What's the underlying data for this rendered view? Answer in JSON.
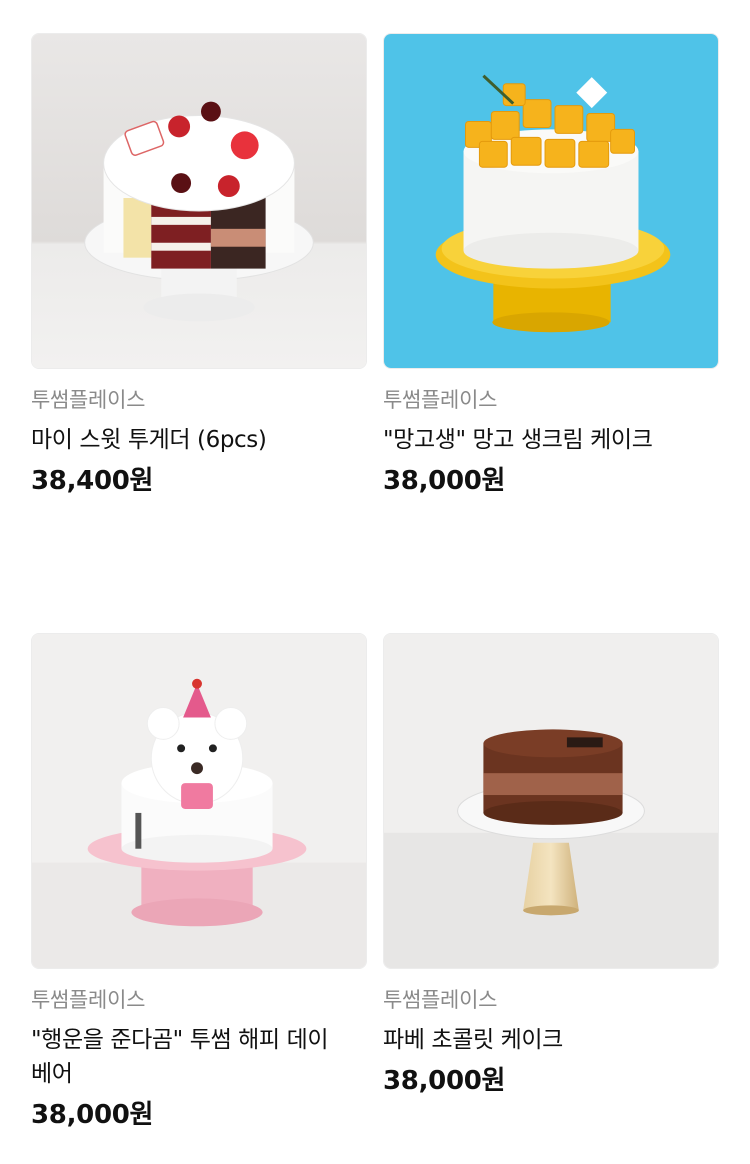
{
  "products": [
    {
      "brand": "투썸플레이스",
      "name": "마이 스윗 투게더 (6pcs)",
      "price": "38,400",
      "currency": "원",
      "image_icon": "six-slice-cake-image"
    },
    {
      "brand": "투썸플레이스",
      "name": "\"망고생\" 망고 생크림 케이크",
      "price": "38,000",
      "currency": "원",
      "image_icon": "mango-cake-image"
    },
    {
      "brand": "투썸플레이스",
      "name": "\"행운을 준다곰\" 투썸 해피 데이 베어",
      "price": "38,000",
      "currency": "원",
      "image_icon": "bear-cake-image"
    },
    {
      "brand": "투썸플레이스",
      "name": "파베 초콜릿 케이크",
      "price": "38,000",
      "currency": "원",
      "image_icon": "chocolate-cake-image"
    }
  ],
  "colors": {
    "brand_text": "#8a8a8a",
    "mango_bg": "#4fc3e8",
    "pink_stand": "#f4b9c6",
    "yellow_stand": "#f3c31a"
  }
}
